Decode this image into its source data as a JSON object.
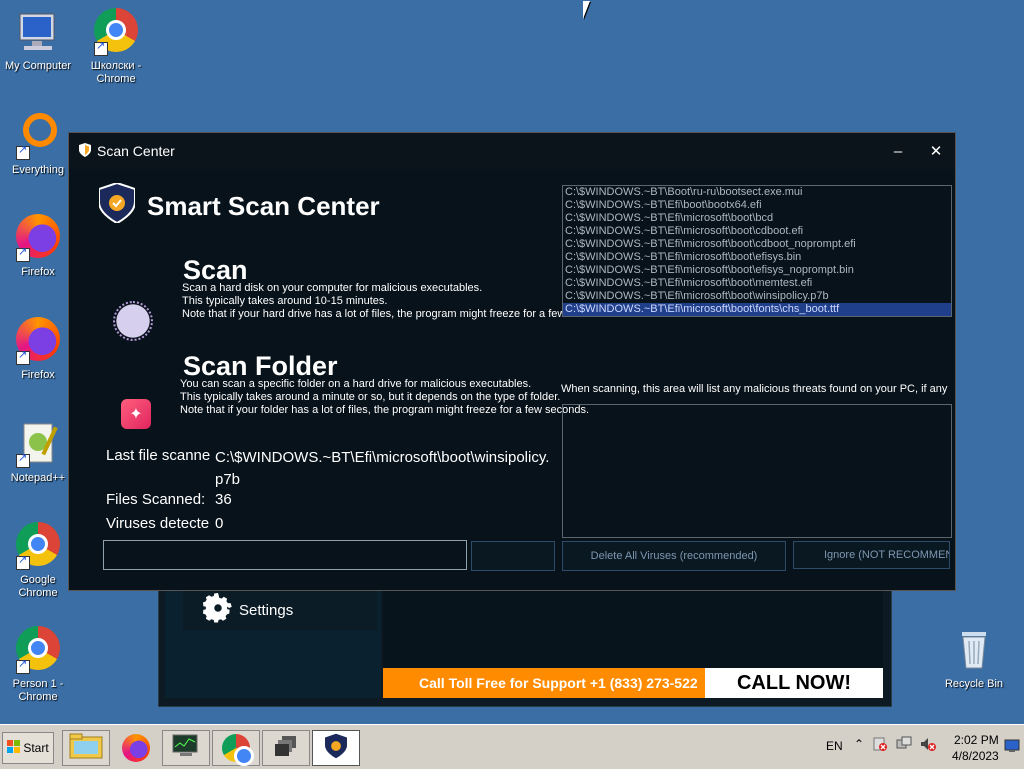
{
  "desktop": {
    "icons": [
      {
        "label": "My Computer"
      },
      {
        "label": "Школски - Chrome"
      },
      {
        "label": "Everything"
      },
      {
        "label": "Firefox"
      },
      {
        "label": "Firefox"
      },
      {
        "label": "Notepad++"
      },
      {
        "label": "Google Chrome"
      },
      {
        "label": "Person 1 - Chrome"
      },
      {
        "label": "Recycle Bin"
      }
    ]
  },
  "background_app": {
    "settings_label": "Settings",
    "banner_text": "Call Toll Free for Support +1 (833) 273-522",
    "call_now": "CALL NOW!"
  },
  "window": {
    "title": "Scan Center",
    "minimize": "–",
    "close": "✕"
  },
  "app": {
    "brand": "Smart Scan Center",
    "scan": {
      "title": "Scan",
      "description": "Scan a hard disk on your computer for malicious executables.\nThis typically takes around 10-15 minutes.\nNote that if your hard drive has a lot of files, the program might freeze for a few seconds."
    },
    "scan_folder": {
      "title": "Scan Folder",
      "description": "You can scan a specific folder on a hard drive for malicious executables.\nThis typically takes around a minute or so, but it depends on the type of folder.\nNote that if your folder has a lot of files, the program might freeze for a few seconds."
    },
    "stats": {
      "last_file_label": "Last file scanne",
      "last_file_value": "C:\\$WINDOWS.~BT\\Efi\\microsoft\\boot\\winsipolicy.p7b",
      "files_scanned_label": "Files Scanned:",
      "files_scanned_value": "36",
      "viruses_label": "Viruses detecte",
      "viruses_value": "0"
    },
    "log": [
      "C:\\$WINDOWS.~BT\\Boot\\ru-ru\\bootsect.exe.mui",
      "C:\\$WINDOWS.~BT\\Efi\\boot\\bootx64.efi",
      "C:\\$WINDOWS.~BT\\Efi\\microsoft\\boot\\bcd",
      "C:\\$WINDOWS.~BT\\Efi\\microsoft\\boot\\cdboot.efi",
      "C:\\$WINDOWS.~BT\\Efi\\microsoft\\boot\\cdboot_noprompt.efi",
      "C:\\$WINDOWS.~BT\\Efi\\microsoft\\boot\\efisys.bin",
      "C:\\$WINDOWS.~BT\\Efi\\microsoft\\boot\\efisys_noprompt.bin",
      "C:\\$WINDOWS.~BT\\Efi\\microsoft\\boot\\memtest.efi",
      "C:\\$WINDOWS.~BT\\Efi\\microsoft\\boot\\winsipolicy.p7b",
      "C:\\$WINDOWS.~BT\\Efi\\microsoft\\boot\\fonts\\chs_boot.ttf"
    ],
    "threats_info": "When scanning, this area will list any malicious threats found on your PC, if any a",
    "buttons": {
      "scan_go": "",
      "delete_all": "Delete All Viruses (recommended)",
      "ignore": "Ignore (NOT RECOMMENDED)"
    }
  },
  "taskbar": {
    "start": "Start",
    "language": "EN",
    "time": "2:02 PM",
    "date": "4/8/2023"
  },
  "colors": {
    "desktop": "#3a6ea5",
    "window_bg": "#08121a",
    "banner": "#ff8b00",
    "selection": "#1f3f8a"
  }
}
